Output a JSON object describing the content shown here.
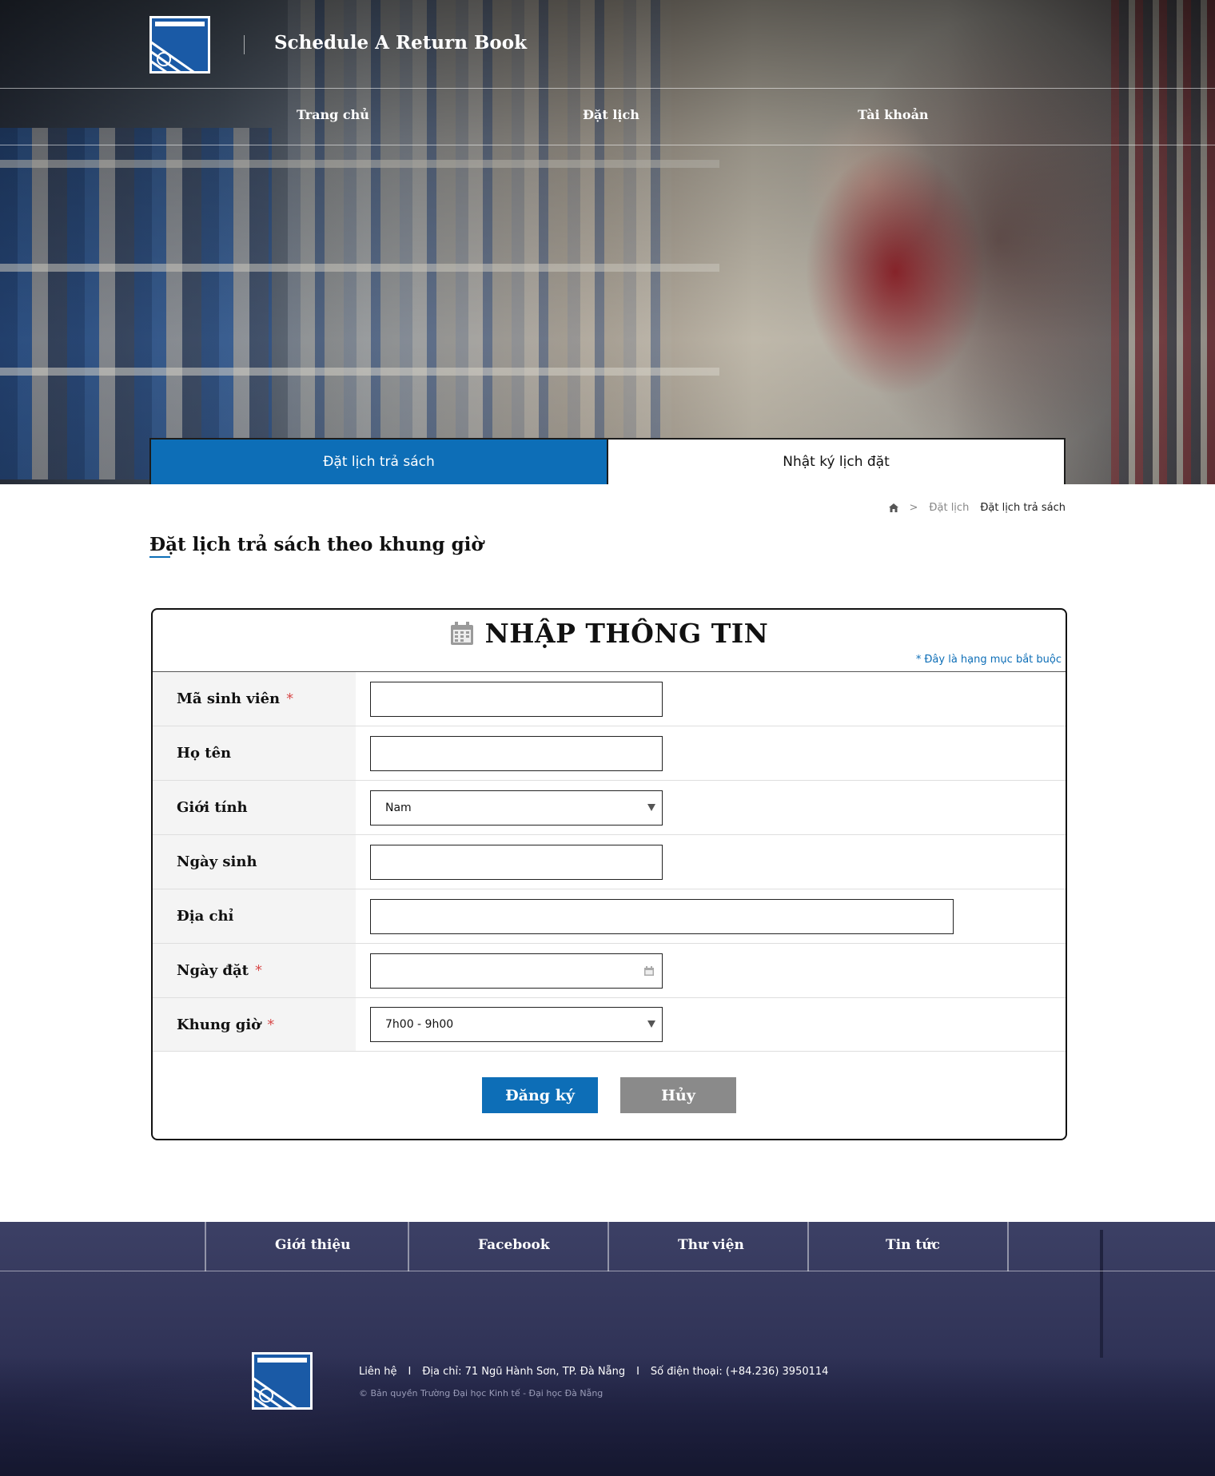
{
  "header": {
    "site_title": "Schedule A Return Book",
    "nav": [
      "Trang chủ",
      "Đặt lịch",
      "Tài khoản"
    ]
  },
  "tabs": {
    "active": "Đặt lịch trả sách",
    "inactive": "Nhật ký lịch đặt"
  },
  "breadcrumb": {
    "icon": "home-icon",
    "separator": ">",
    "parent": "Đặt lịch",
    "current": "Đặt lịch trả sách"
  },
  "page_title": "Đặt lịch trả sách theo khung giờ",
  "form": {
    "icon": "calendar-icon",
    "heading": "NHẬP THÔNG TIN",
    "required_star": "*",
    "required_note": "Đây là hạng mục bắt buộc",
    "fields": {
      "student_id": {
        "label": "Mã sinh viên",
        "value": ""
      },
      "full_name": {
        "label": "Họ tên",
        "value": ""
      },
      "gender": {
        "label": "Giới tính",
        "value": "Nam"
      },
      "birth_date": {
        "label": "Ngày sinh",
        "value": ""
      },
      "address": {
        "label": "Địa chỉ",
        "value": ""
      },
      "booking_date": {
        "label": "Ngày đặt",
        "value": ""
      },
      "time_slot": {
        "label": "Khung giờ",
        "value": "7h00 - 9h00"
      }
    },
    "submit_label": "Đăng ký",
    "cancel_label": "Hủy"
  },
  "footer": {
    "nav": [
      "Giới thiệu",
      "Facebook",
      "Thư viện",
      "Tin tức"
    ],
    "contact_label": "Liên hệ",
    "separator": "I",
    "address": "Địa chỉ: 71 Ngũ Hành Sơn, TP. Đà Nẵng",
    "phone": "Số điện thoại: (+84.236) 3950114",
    "copyright": "© Bản quyền Trường Đại học Kinh tế - Đại học Đà Nẵng"
  },
  "colors": {
    "accent": "#0d6eb7",
    "required": "#d84a4a",
    "cancel": "#8a8a8a",
    "footer_bg": "#33365a"
  }
}
